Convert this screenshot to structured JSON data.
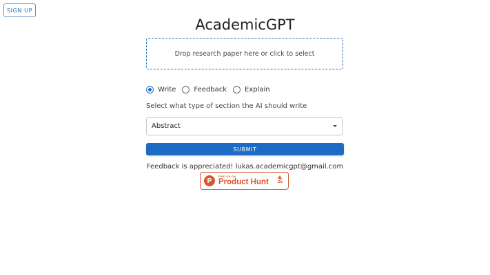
{
  "header": {
    "signup_label": "SIGN UP"
  },
  "main": {
    "title": "AcademicGPT",
    "dropzone_text": "Drop research paper here or click to select",
    "modes": [
      {
        "label": "Write",
        "checked": true
      },
      {
        "label": "Feedback",
        "checked": false
      },
      {
        "label": "Explain",
        "checked": false
      }
    ],
    "section_prompt": "Select what type of section the AI should write",
    "section_select_value": "Abstract",
    "submit_label": "SUBMIT",
    "feedback_text": "Feedback is appreciated! lukas.academicgpt@gmail.com"
  },
  "product_hunt": {
    "logo_letter": "P",
    "small_text": "FIND US ON",
    "big_text": "Product Hunt",
    "votes": "25"
  },
  "colors": {
    "accent": "#1e6bb8",
    "product_hunt": "#da552f"
  }
}
